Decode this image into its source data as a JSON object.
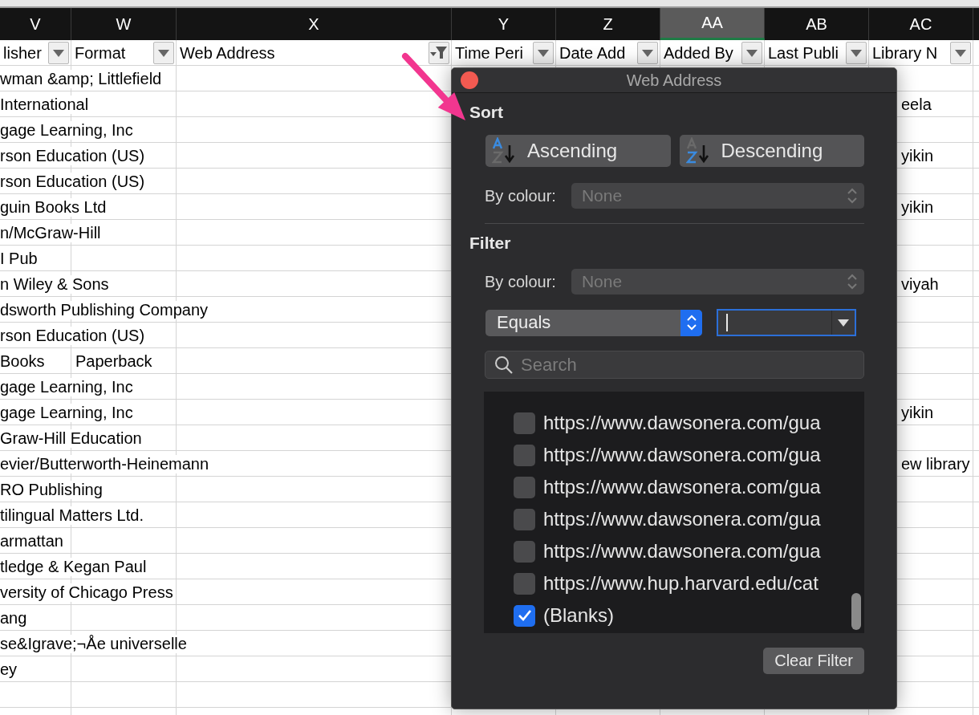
{
  "column_letters": [
    {
      "letter": "V",
      "selected": false
    },
    {
      "letter": "W",
      "selected": false
    },
    {
      "letter": "X",
      "selected": false
    },
    {
      "letter": "Y",
      "selected": false
    },
    {
      "letter": "Z",
      "selected": false
    },
    {
      "letter": "AA",
      "selected": true
    },
    {
      "letter": "AB",
      "selected": false
    },
    {
      "letter": "AC",
      "selected": false
    }
  ],
  "header_row": [
    {
      "label": "lisher",
      "filtered": false
    },
    {
      "label": "Format",
      "filtered": false
    },
    {
      "label": "Web Address",
      "filtered": true
    },
    {
      "label": "Time Peri",
      "filtered": false
    },
    {
      "label": "Date Add",
      "filtered": false
    },
    {
      "label": "Added By",
      "filtered": false
    },
    {
      "label": "Last Publi",
      "filtered": false
    },
    {
      "label": "Library N",
      "filtered": false
    }
  ],
  "rows": [
    {
      "publisher": "wman &amp; Littlefield"
    },
    {
      "publisher": "International",
      "library_no": "eela"
    },
    {
      "publisher": "gage Learning, Inc"
    },
    {
      "publisher": "rson Education (US)",
      "library_no": "yikin"
    },
    {
      "publisher": "rson Education (US)"
    },
    {
      "publisher": "guin Books Ltd",
      "library_no": "yikin"
    },
    {
      "publisher": "n/McGraw-Hill"
    },
    {
      "publisher": "I Pub"
    },
    {
      "publisher": "n Wiley & Sons",
      "library_no": "viyah"
    },
    {
      "publisher": "dsworth Publishing Company"
    },
    {
      "publisher": "rson Education (US)"
    },
    {
      "publisher": "Books",
      "format": "Paperback"
    },
    {
      "publisher": "gage Learning, Inc"
    },
    {
      "publisher": "gage Learning, Inc",
      "library_no": "yikin"
    },
    {
      "publisher": "Graw-Hill Education"
    },
    {
      "publisher": "evier/Butterworth-Heinemann",
      "library_no": "ew library"
    },
    {
      "publisher": "RO Publishing"
    },
    {
      "publisher": "tilingual Matters Ltd."
    },
    {
      "publisher": "armattan"
    },
    {
      "publisher": "tledge & Kegan Paul"
    },
    {
      "publisher": "versity of Chicago Press"
    },
    {
      "publisher": "ang"
    },
    {
      "publisher": "se&Igrave;¬Åe universelle"
    },
    {
      "publisher": "ey"
    }
  ],
  "filter_popup": {
    "title": "Web Address",
    "sort": {
      "heading": "Sort",
      "buttons": [
        {
          "kind": "ascending",
          "label": "Ascending"
        },
        {
          "kind": "descending",
          "label": "Descending"
        }
      ],
      "by_colour": {
        "label": "By colour:",
        "value": "None",
        "disabled": true
      }
    },
    "filter": {
      "heading": "Filter",
      "by_colour": {
        "label": "By colour:",
        "value": "None",
        "disabled": true
      },
      "condition": {
        "value": "Equals"
      },
      "criteria_field": {
        "focused": true
      },
      "search": {
        "placeholder": "Search"
      },
      "items": [
        {
          "label": "https://www.dawsonera.com/gua",
          "checked": false
        },
        {
          "label": "https://www.dawsonera.com/gua",
          "checked": false
        },
        {
          "label": "https://www.dawsonera.com/gua",
          "checked": false
        },
        {
          "label": "https://www.dawsonera.com/gua",
          "checked": false
        },
        {
          "label": "https://www.dawsonera.com/gua",
          "checked": false
        },
        {
          "label": "https://www.hup.harvard.edu/cat",
          "checked": false
        },
        {
          "label": "(Blanks)",
          "checked": true
        }
      ]
    },
    "clear_button": "Clear Filter"
  }
}
